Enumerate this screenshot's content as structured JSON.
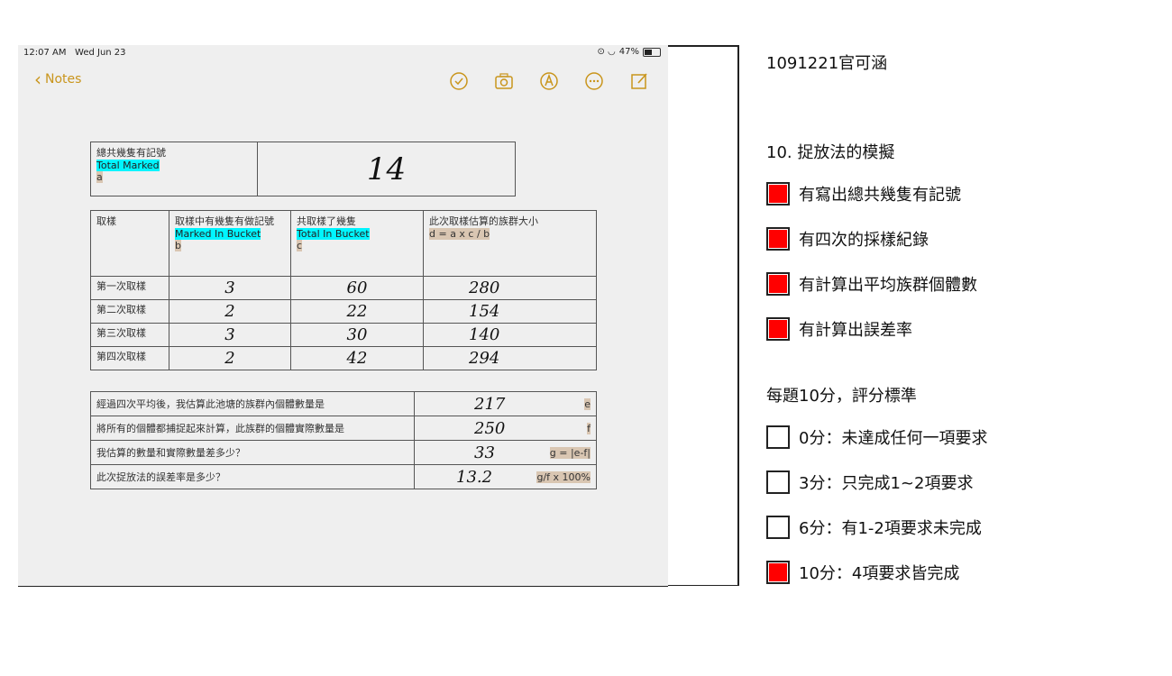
{
  "ipad": {
    "status_time": "12:07 AM",
    "status_date": "Wed Jun 23",
    "battery": "47%",
    "battery_level": 0.47,
    "back_label": "Notes",
    "toolbar_icons": [
      "checklist-icon",
      "camera-icon",
      "markup-icon",
      "more-icon",
      "compose-icon"
    ]
  },
  "sheet": {
    "table1": {
      "label_zh": "總共幾隻有記號",
      "label_en": "Total Marked",
      "label_var": "a",
      "value": "14"
    },
    "table2": {
      "headers": [
        {
          "zh": "取樣",
          "en": "",
          "var": ""
        },
        {
          "zh": "取樣中有幾隻有做記號",
          "en": "Marked In Bucket",
          "var": "b"
        },
        {
          "zh": "共取樣了幾隻",
          "en": "Total In Bucket",
          "var": "c"
        },
        {
          "zh": "此次取樣估算的族群大小",
          "en": "d = a x c / b",
          "var": ""
        }
      ],
      "rows": [
        {
          "label": "第一次取樣",
          "b": "3",
          "c": "60",
          "d": "280"
        },
        {
          "label": "第二次取樣",
          "b": "2",
          "c": "22",
          "d": "154"
        },
        {
          "label": "第三次取樣",
          "b": "3",
          "c": "30",
          "d": "140"
        },
        {
          "label": "第四次取樣",
          "b": "2",
          "c": "42",
          "d": "294"
        }
      ]
    },
    "table3": [
      {
        "question": "經過四次平均後，我估算此池塘的族群內個體數量是",
        "answer": "217",
        "tag": "e"
      },
      {
        "question": "將所有的個體都捕捉起來計算，此族群的個體實際數量是",
        "answer": "250",
        "tag": "f"
      },
      {
        "question": "我估算的數量和實際數量差多少？",
        "answer": "33",
        "tag": "g = |e-f|"
      },
      {
        "question": "此次捉放法的誤差率是多少？",
        "answer": "13.2",
        "tag": "g/f x 100%"
      }
    ]
  },
  "rubric": {
    "student": "1091221官可涵",
    "question_title": "10. 捉放法的模擬",
    "criteria": [
      {
        "label": "有寫出總共幾隻有記號",
        "checked": true
      },
      {
        "label": "有四次的採樣紀錄",
        "checked": true
      },
      {
        "label": "有計算出平均族群個體數",
        "checked": true
      },
      {
        "label": "有計算出誤差率",
        "checked": true
      }
    ],
    "scoring_title": "每題10分，評分標準",
    "scores": [
      {
        "label": "0分：未達成任何一項要求",
        "checked": false
      },
      {
        "label": "3分：只完成1~2項要求",
        "checked": false
      },
      {
        "label": "6分：有1-2項要求未完成",
        "checked": false
      },
      {
        "label": "10分：4項要求皆完成",
        "checked": true
      }
    ]
  },
  "colors": {
    "checked": "#ff0000",
    "highlight_cyan": "#00f5ff",
    "highlight_tan": "#d9c6b2",
    "notes_accent": "#c9951c"
  }
}
